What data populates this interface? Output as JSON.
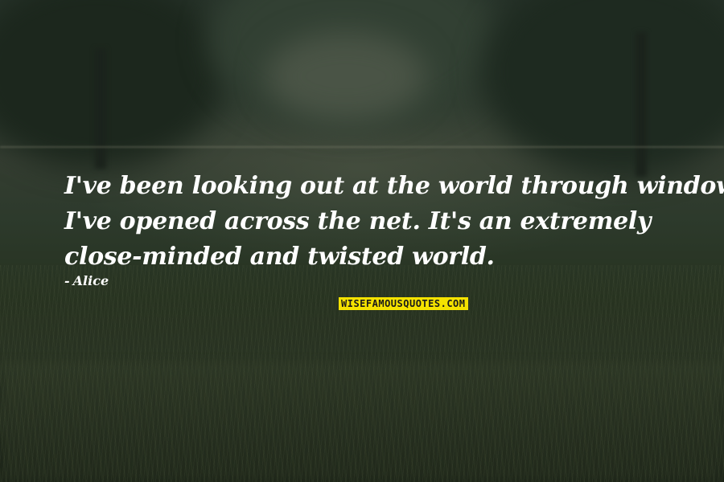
{
  "background": {
    "description_colors": {
      "sky": "#2c382d",
      "grass": "#26321f",
      "watermark_bg": "#f5e200"
    }
  },
  "quote": {
    "lines": [
      "I've been looking out at the world through windows",
      "I've opened across the net. It's an extremely",
      "close-minded and twisted world."
    ]
  },
  "author": {
    "dash": "-",
    "name": "Alice"
  },
  "watermark": {
    "text": "WISEFAMOUSQUOTES.COM"
  }
}
